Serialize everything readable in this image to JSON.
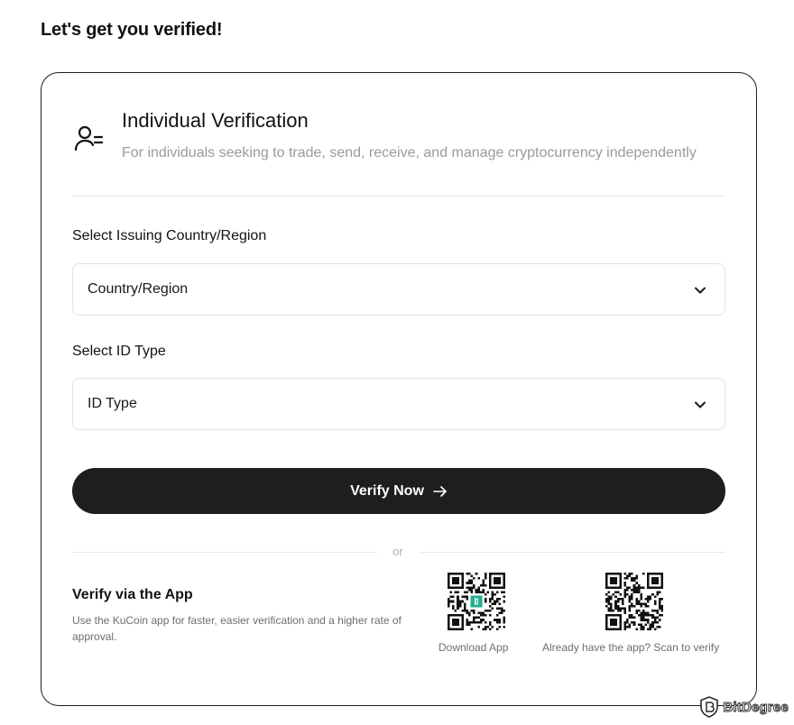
{
  "page": {
    "title": "Let's get you verified!"
  },
  "card": {
    "heading": "Individual Verification",
    "subheading": "For individuals seeking to trade, send, receive, and manage cryptocurrency independently"
  },
  "country": {
    "label": "Select Issuing Country/Region",
    "placeholder": "Country/Region"
  },
  "id_type": {
    "label": "Select ID Type",
    "placeholder": "ID Type"
  },
  "verify": {
    "label": "Verify Now"
  },
  "separator": {
    "label": "or"
  },
  "app": {
    "title": "Verify via the App",
    "description": "Use the KuCoin app for faster, easier verification and a higher rate of approval.",
    "download_label": "Download App",
    "scan_label": "Already have the app? Scan to verify"
  },
  "watermark": {
    "name": "BitDegree"
  },
  "colors": {
    "button": "#1e1e1e",
    "muted": "#9a9a9a",
    "border": "#e3e3e3",
    "kucoin_green": "#23af91"
  },
  "icons": {
    "header": "user-list-icon",
    "dropdown": "chevron-down-icon",
    "button": "arrow-right-icon",
    "watermark": "bitdegree-shield-icon"
  }
}
